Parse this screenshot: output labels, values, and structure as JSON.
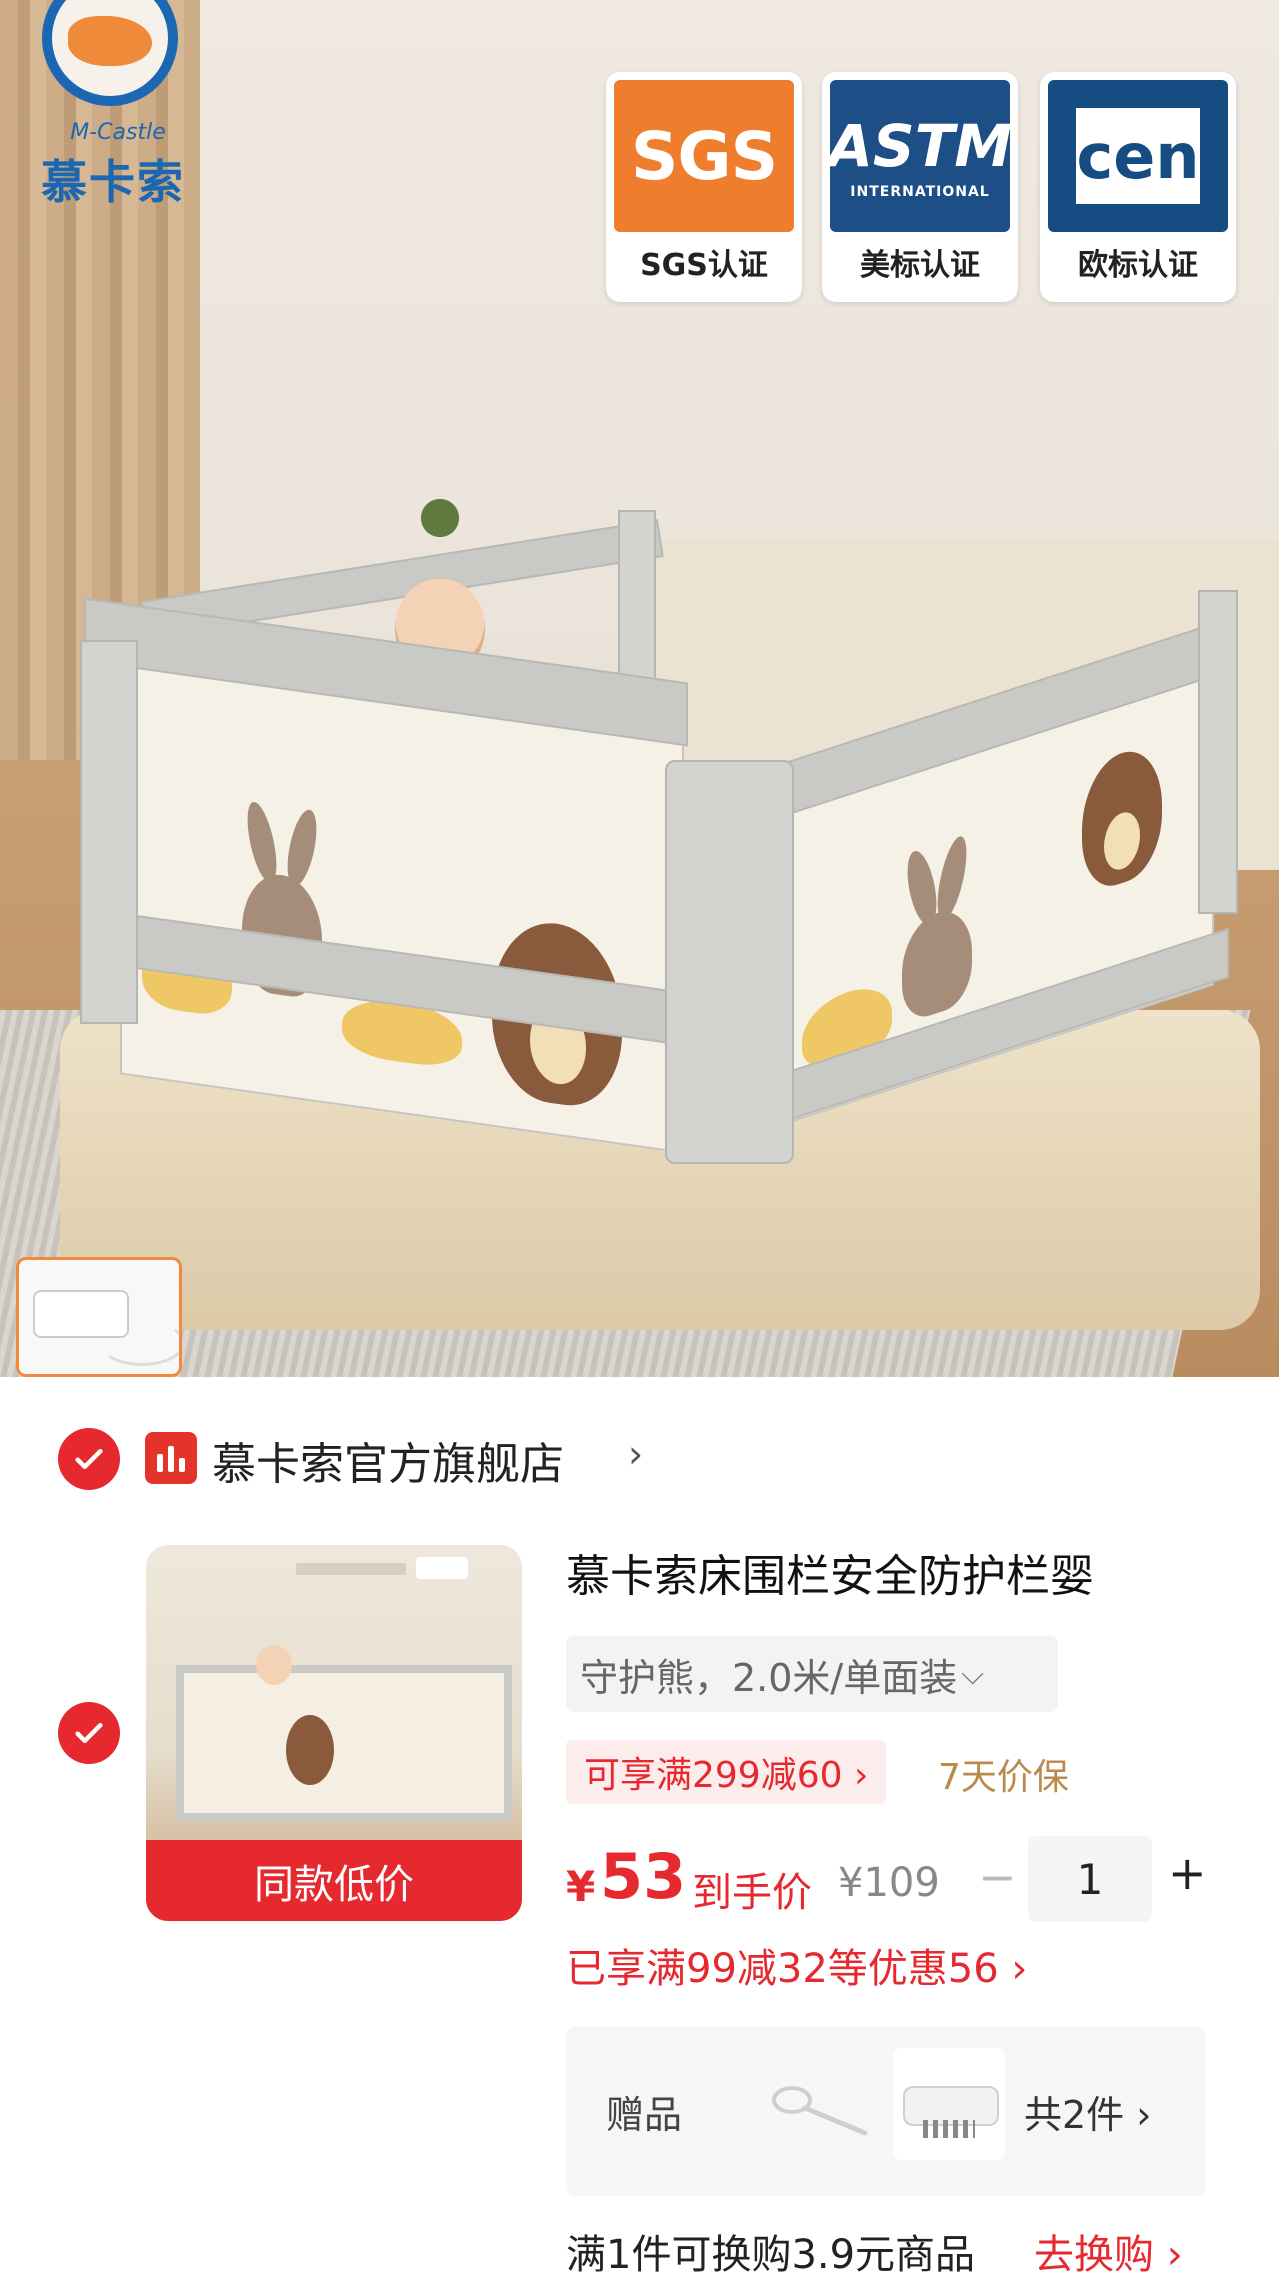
{
  "hero": {
    "logo": {
      "sub": "M-Castle",
      "name": "慕卡索"
    },
    "certs": [
      {
        "mark": "SGS",
        "label": "SGS认证"
      },
      {
        "mark": "ASTM",
        "sub": "INTERNATIONAL",
        "label": "美标认证"
      },
      {
        "mark": "cen",
        "label": "欧标认证"
      }
    ]
  },
  "store": {
    "name": "慕卡索官方旗舰店",
    "chevron": "›"
  },
  "product": {
    "badge": "同款低价",
    "title": "慕卡索床围栏安全防护栏婴",
    "variant": "守护熊，2.0米/单面装",
    "promo": "可享满299减60 ›",
    "protection": "7天价保",
    "price_symbol": "¥",
    "price": "53",
    "price_label": "到手价",
    "original_price": "¥109",
    "quantity": "1",
    "minus": "−",
    "plus": "+",
    "enjoyed": "已享满99减32等优惠56 ›"
  },
  "gift": {
    "label": "赠品",
    "count": "共2件 ›"
  },
  "swap": {
    "text": "满1件可换购3.9元商品",
    "link": "去换购 ›"
  },
  "colors": {
    "accent": "#e6282f",
    "brand_blue": "#1c67b1",
    "sgs_orange": "#ee7e2d"
  }
}
